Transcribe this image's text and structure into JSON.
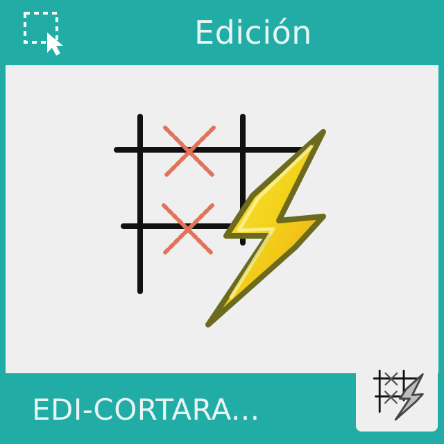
{
  "header": {
    "title": "Edición",
    "select_icon": "selection-cursor-icon"
  },
  "tile": {
    "label": "EDI-CORTARA...",
    "main_icon": "ladder-cut-lightning-icon",
    "thumbnail_icon": "ladder-cut-lightning-thumbnail-icon"
  },
  "colors": {
    "accent": "#21ada5",
    "panel": "#efefef",
    "text": "#e9f5f4",
    "cross": "#e0735a",
    "bolt_yellow": "#f3d21a",
    "bolt_orange": "#f2a20f",
    "bolt_outline": "#6b6a1e"
  }
}
